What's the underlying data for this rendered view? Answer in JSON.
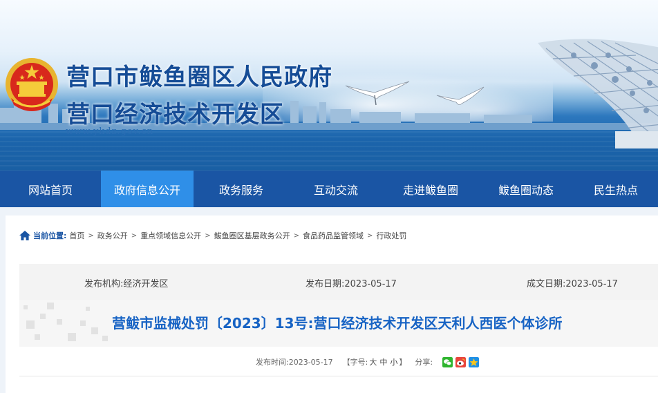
{
  "header": {
    "title_main": "营口市鲅鱼圈区人民政府",
    "title_sub": "营口经济技术开发区",
    "url": "www.ykdz.gov.cn",
    "emblem_icon": "national-emblem-icon"
  },
  "nav": {
    "items": [
      {
        "label": "网站首页",
        "active": false
      },
      {
        "label": "政府信息公开",
        "active": true
      },
      {
        "label": "政务服务",
        "active": false
      },
      {
        "label": "互动交流",
        "active": false
      },
      {
        "label": "走进鲅鱼圈",
        "active": false
      },
      {
        "label": "鲅鱼圈动态",
        "active": false
      },
      {
        "label": "民生热点",
        "active": false
      }
    ],
    "bg_color": "#1a55a4",
    "active_color": "#2f8fe8"
  },
  "breadcrumb": {
    "label": "当前位置:",
    "items": [
      "首页",
      "政务公开",
      "重点领域信息公开",
      "鲅鱼圈区基层政务公开",
      "食品药品监管领域",
      "行政处罚"
    ],
    "separator": ">"
  },
  "meta": {
    "publisher": "发布机构:经济开发区",
    "publish_date": "发布日期:2023-05-17",
    "created_date": "成文日期:2023-05-17"
  },
  "article": {
    "title": "营鲅市监械处罚〔2023〕13号:营口经济技术开发区天利人西医个体诊所",
    "publish_time": "发布时间:2023-05-17",
    "font_size_label": "【字号:",
    "font_large": "大",
    "font_medium": "中",
    "font_small": "小",
    "font_size_end": "】",
    "share_label": "分享:",
    "share_icons": [
      "wechat-icon",
      "weibo-icon",
      "qzone-icon"
    ]
  }
}
